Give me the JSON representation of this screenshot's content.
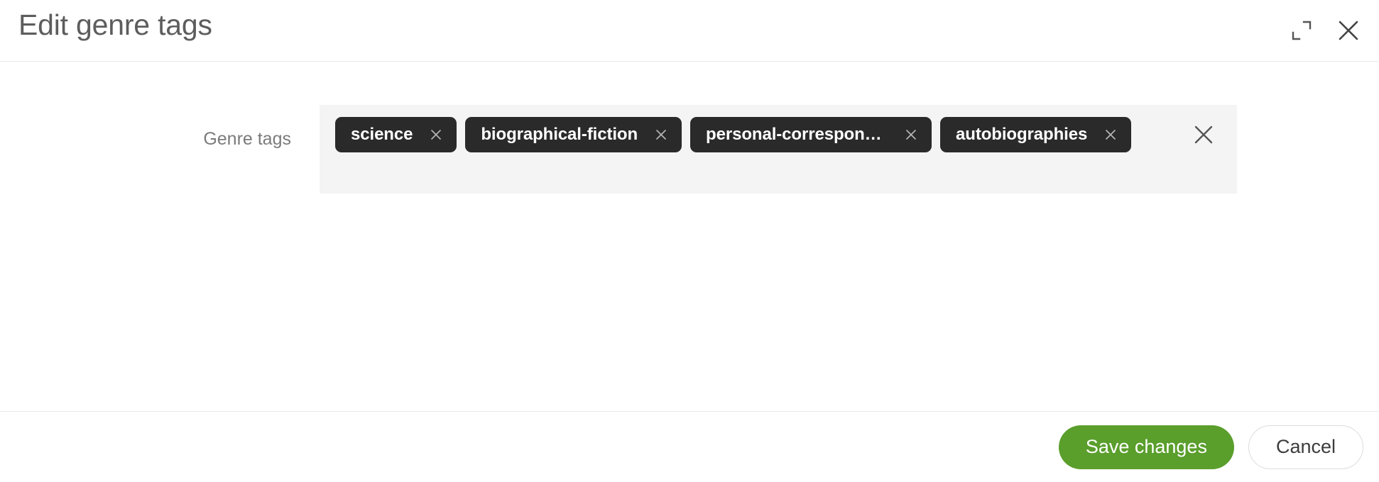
{
  "dialog": {
    "title": "Edit genre tags",
    "header_actions": [
      {
        "name": "expand-icon",
        "label": "Expand"
      },
      {
        "name": "close-icon",
        "label": "Close"
      }
    ]
  },
  "form": {
    "field_label": "Genre tags",
    "tags": [
      {
        "label": "science",
        "remove_icon": "close-icon"
      },
      {
        "label": "biographical-fiction",
        "remove_icon": "close-icon"
      },
      {
        "label": "personal-corresponde...",
        "remove_icon": "close-icon"
      },
      {
        "label": "autobiographies",
        "remove_icon": "close-icon"
      }
    ],
    "clear_all_icon": "close-icon",
    "input_placeholder": ""
  },
  "footer": {
    "save_label": "Save changes",
    "cancel_label": "Cancel"
  },
  "colors": {
    "accent_green": "#5a9e2c",
    "chip_background": "#2a2a2a",
    "field_background": "#f4f4f4",
    "title_text": "#5d5d5d",
    "label_text": "#7b7b7b",
    "divider": "#e8e8e8"
  }
}
